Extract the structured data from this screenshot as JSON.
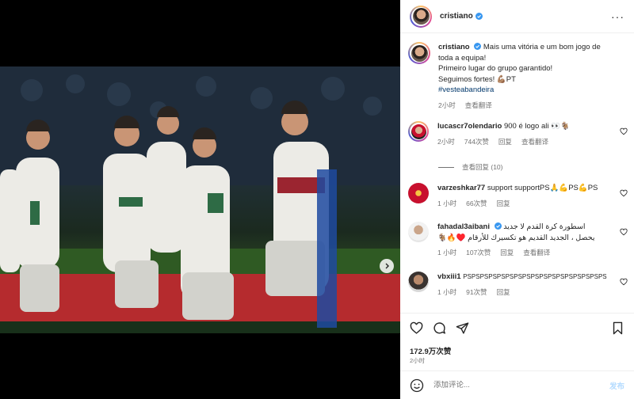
{
  "header": {
    "username": "cristiano"
  },
  "caption": {
    "username": "cristiano",
    "lines": [
      "Mais uma vitória e um bom jogo de",
      "toda a equipa!",
      "Primeiro lugar do grupo garantido!",
      "Seguimos fortes! 💪🏽PT"
    ],
    "hashtag": "#vesteabandeira",
    "time": "2小时",
    "translate": "查看翻译"
  },
  "comments": [
    {
      "username": "lucascr7olendario",
      "text": "900 é logo ali 👀🐐",
      "time": "2小时",
      "likes": "744次赞",
      "reply": "回复",
      "translate": "查看翻译",
      "replies": "查看回复 (10)"
    },
    {
      "username": "varzeshkar77",
      "text": "support supportPS🙏💪PS💪PS",
      "time": "1 小时",
      "likes": "66次赞",
      "reply": "回复"
    },
    {
      "username": "fahadal3aibani",
      "text_line1": "اسطورة كرة القدم لا جديد",
      "text_line2": "يحصل ، الجديد القديم هو تكسيرك للأرقام ♥️🔥🐐",
      "time": "1 小时",
      "likes": "107次赞",
      "reply": "回复",
      "translate": "查看翻译"
    },
    {
      "username": "vbxiii1",
      "text": "PSPSPSPSPSPSPSPSPSPSPSPSPSPSPSPSPS",
      "time": "1 小时",
      "likes": "91次赞",
      "reply": "回复"
    }
  ],
  "actions": {
    "likes": "172.9万次赞",
    "date": "2小时"
  },
  "composer": {
    "placeholder": "添加评论...",
    "post": "发布"
  },
  "colors": {
    "verified": "#3897f0",
    "link": "#00376b",
    "muted": "#737373",
    "accent": "#3797f0"
  }
}
